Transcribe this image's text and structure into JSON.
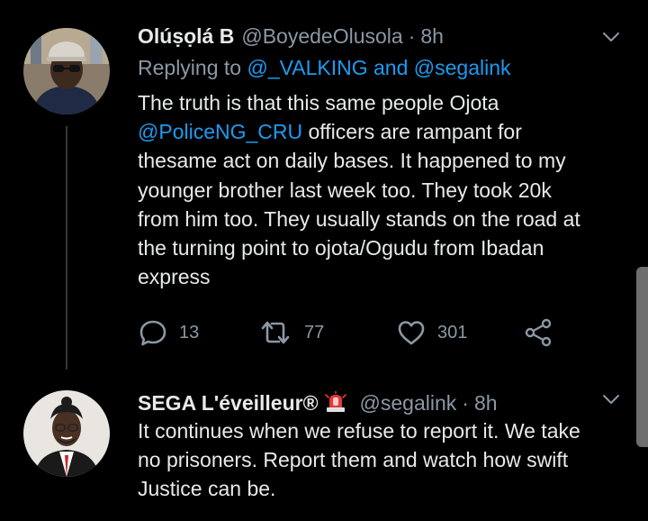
{
  "tweet1": {
    "author_name": "Olúṣọlá B",
    "handle": "@BoyedeOlusola",
    "separator": "·",
    "time": "8h",
    "replying_prefix": "Replying to",
    "replying_user1": "@_VALKING",
    "replying_and": "and",
    "replying_user2": "@segalink",
    "body_line1": "The truth is that this same people Ojota",
    "body_mention": "@PoliceNG_CRU",
    "body_line2_rest": " officers are rampant for",
    "body_line3": "thesame act on daily bases. It happened to my",
    "body_line4": "younger brother last week too. They took 20k",
    "body_line5": "from him too. They usually stands on the road at",
    "body_line6": "the turning point to ojota/Ogudu from Ibadan",
    "body_line7": "express",
    "replies": "13",
    "retweets": "77",
    "likes": "301"
  },
  "tweet2": {
    "author_name": "SEGA L'éveilleur®",
    "name_emoji": "🚨",
    "handle": "@segalink",
    "separator": "·",
    "time": "8h",
    "body_line1": "It continues when we refuse to report it. We take",
    "body_line2": "no prisoners. Report them and watch how swift",
    "body_line3": "Justice can be."
  },
  "icons": {
    "reply": "reply-icon",
    "retweet": "retweet-icon",
    "like": "heart-icon",
    "share": "share-icon",
    "more": "chevron-down-icon"
  },
  "colors": {
    "background": "#000000",
    "text": "#e7e9ea",
    "muted": "#8b98a5",
    "link": "#1d9bf0",
    "thread_line": "#333639"
  }
}
